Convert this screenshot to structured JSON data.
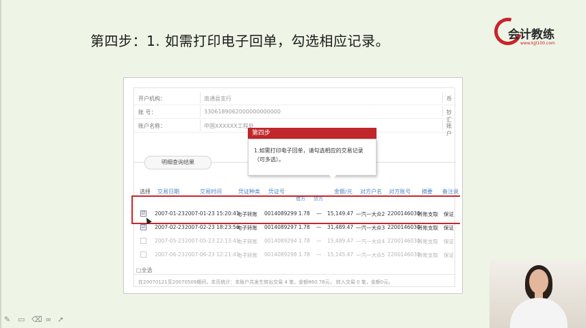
{
  "slide": {
    "title": "第四步：1. 如需打印电子回单，勾选相应记录。"
  },
  "logo": {
    "brand": "会计教练",
    "url": "www.kjjl100.com"
  },
  "account_info": {
    "rows": [
      {
        "label": "开户机构：",
        "value": "南通县支行",
        "trail": "币"
      },
      {
        "label": "账    号：",
        "value": "3306189062000000000000",
        "trail": "钞汇"
      },
      {
        "label": "账户名称：",
        "value": "中国XXXXXX工程处",
        "trail": "账户"
      }
    ]
  },
  "result_tab": "明细查询结果",
  "table": {
    "headers": {
      "select": "选择",
      "date": "交易日期",
      "time": "交易时间",
      "voucher_type": "凭证种类",
      "voucher_no": "凭证号",
      "debit": "借方",
      "credit": "贷方",
      "amount": "金额/元",
      "counterparty": "对方户名",
      "counter_account": "对方账号",
      "summary": "摘要",
      "remark": "备注说"
    },
    "rows": [
      {
        "checked": "☑",
        "date": "2007-01-23",
        "time": "2007-01-23 15:20:41",
        "vtype": "电子转账",
        "vno": "0014089299",
        "rate": "1.78",
        "dash": "—",
        "amount": "15,149.47",
        "cp": "一汽一大众2",
        "acct": "2200146030",
        "summary": "转账支取",
        "remark": "保证"
      },
      {
        "checked": "☑",
        "date": "2007-02-23",
        "time": "2007-02-23 18:23:56",
        "vtype": "电子转账",
        "vno": "0014089297",
        "rate": "1.78",
        "dash": "—",
        "amount": "31,489.47",
        "cp": "一汽一大众3",
        "acct": "2200146030",
        "summary": "转账支取",
        "remark": "保证"
      },
      {
        "checked": "",
        "date": "2007-05-23",
        "time": "2007-05-23 22:13:41",
        "vtype": "电子转账",
        "vno": "0014089294",
        "rate": "1.78",
        "dash": "—",
        "amount": "15,489.47",
        "cp": "一汽一大众4",
        "acct": "2200146030",
        "summary": "转账支取",
        "remark": "保证"
      },
      {
        "checked": "",
        "date": "2007-06-23",
        "time": "2007-06-23 12:21:41",
        "vtype": "电子转账",
        "vno": "0014089298",
        "rate": "1.78",
        "dash": "—",
        "amount": "15,145.47",
        "cp": "一汽一大众5",
        "acct": "2200146030",
        "summary": "转账支取",
        "remark": "保证"
      }
    ],
    "select_all": "□全选",
    "footer": "在20070121至20070509期间，本页统计：本账户共发生转出交易 4 笔，金额860.78元，  转入交易 0 笔，金额0元。"
  },
  "tooltip": {
    "header": "第四步",
    "body": "1.如需打印电子回单，请勾选相应的交易记录（可多选）。"
  },
  "colors": {
    "accent_red": "#c0262a",
    "link_blue": "#4a86c5",
    "slide_bg": "#eef4e6"
  }
}
